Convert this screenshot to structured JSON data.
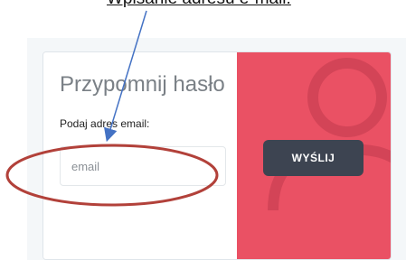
{
  "annotation": {
    "caption": "Wpisanie adresu e-mail:"
  },
  "form": {
    "title": "Przypomnij hasło",
    "email_label": "Podaj adres email:",
    "email_placeholder": "email",
    "email_value": "",
    "submit_label": "WYŚLIJ"
  },
  "icons": {
    "background_icon": "user-icon"
  },
  "colors": {
    "accent_panel": "#ea5164",
    "button": "#3d4451",
    "annotation_ellipse": "#b2413a",
    "annotation_arrow": "#4472c4"
  }
}
